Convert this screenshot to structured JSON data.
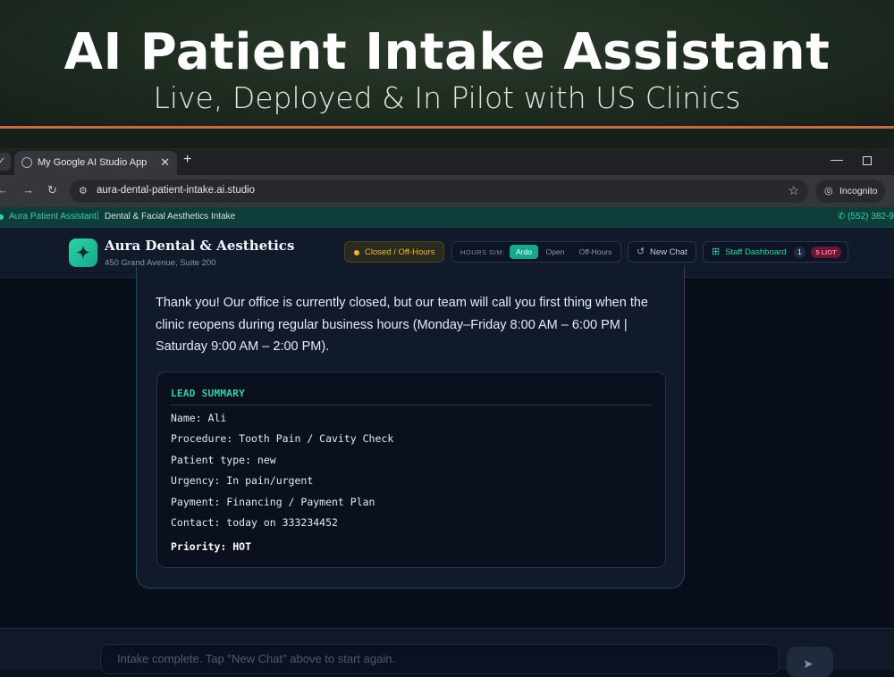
{
  "banner": {
    "title": "AI Patient Intake Assistant",
    "subtitle": "Live, Deployed & In Pilot with US Clinics"
  },
  "browser": {
    "tab_title": "My Google AI Studio App",
    "url": "aura-dental-patient-intake.ai.studio",
    "profile_label": "Incognito"
  },
  "strip": {
    "app_name": "Aura Patient Assistant",
    "separator": "|",
    "subtitle": "Dental & Facial Aesthetics Intake",
    "phone": "(552) 382-9"
  },
  "header": {
    "clinic_name": "Aura Dental & Aesthetics",
    "clinic_address": "450 Grand Avenue, Suite 200",
    "status": "Closed / Off-Hours",
    "hours_sim_label": "HOURS SIM:",
    "hours_options": [
      "Ardo",
      "Open",
      "Off-Hours"
    ],
    "hours_selected": "Ardo",
    "new_chat_label": "New Chat",
    "staff_dashboard_label": "Staff Dashboard",
    "staff_count": "1",
    "staff_badge": "5 LIOT"
  },
  "chat": {
    "message": "Thank you! Our office is currently closed, but our team will call you first thing when the clinic reopens during regular business hours (Monday–Friday 8:00 AM – 6:00 PM | Saturday 9:00 AM – 2:00 PM).",
    "lead_summary": {
      "heading": "LEAD SUMMARY",
      "lines": [
        "Name: Ali",
        "Procedure: Tooth Pain / Cavity Check",
        "Patient type: new",
        "Urgency: In pain/urgent",
        "Payment: Financing / Payment Plan",
        "Contact: today on 333234452"
      ],
      "priority": "Priority: HOT"
    }
  },
  "composer": {
    "placeholder": "Intake complete. Tap \"New Chat\" above to start again."
  },
  "colors": {
    "accent": "#2dd4a8",
    "status_amber": "#f2b632",
    "banner_rule": "#c86a47",
    "badge_pink": "#ff7aa2"
  }
}
